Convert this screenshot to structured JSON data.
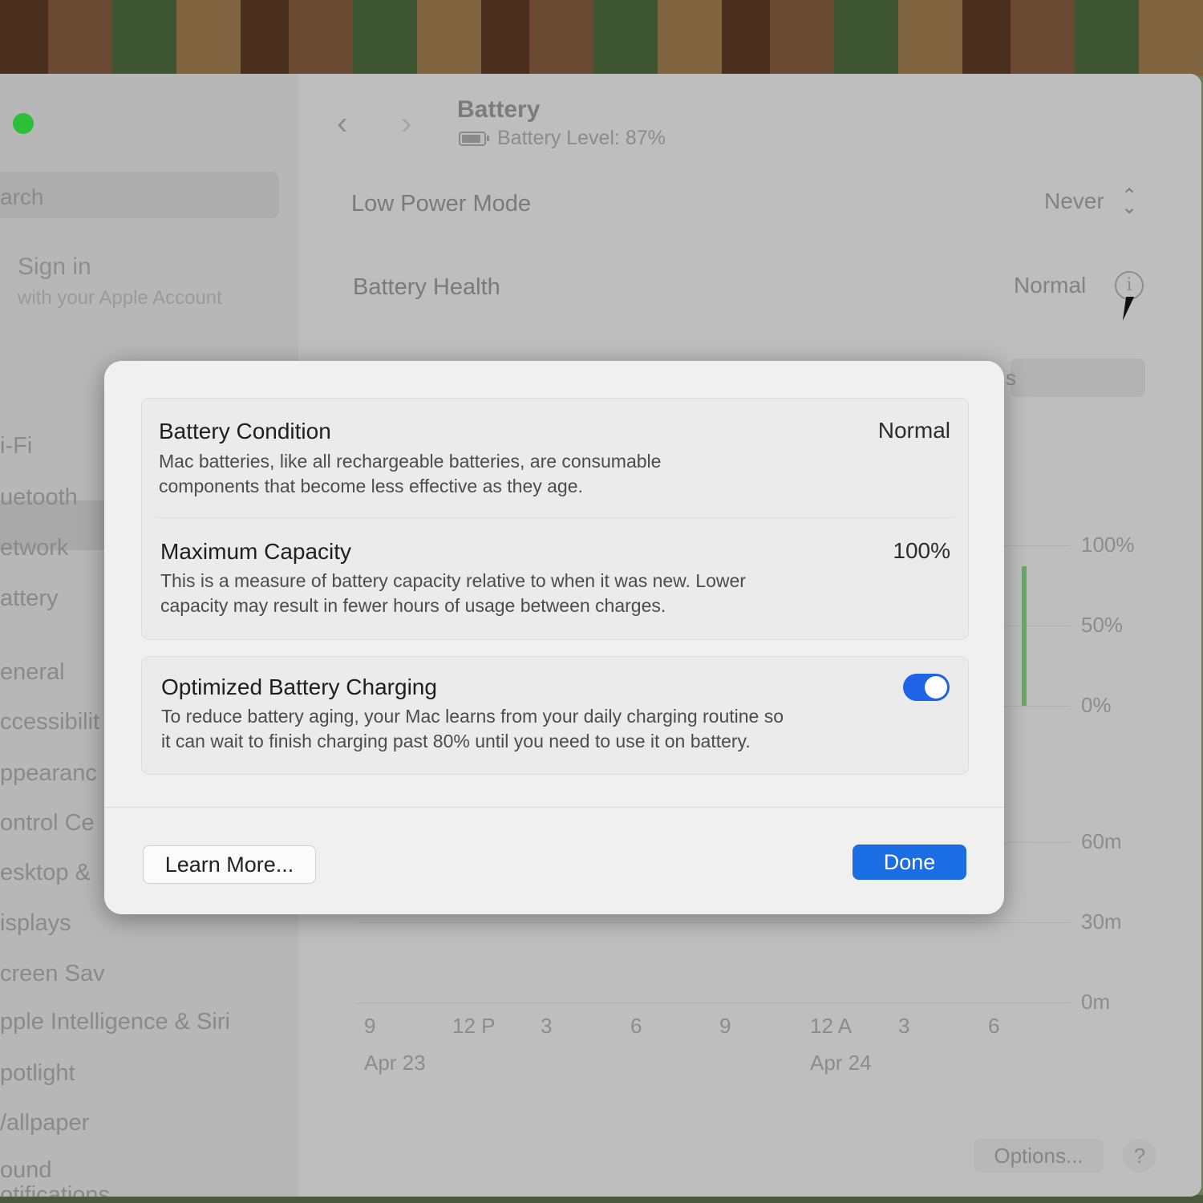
{
  "header": {
    "title": "Battery",
    "battery_level": "Battery Level: 87%",
    "battery_fraction": 0.87
  },
  "sidebar": {
    "search_text": "arch",
    "signin_title": "Sign in",
    "signin_subtitle": "with your Apple Account",
    "items": [
      {
        "label": "i-Fi"
      },
      {
        "label": "uetooth"
      },
      {
        "label": "etwork"
      },
      {
        "label": "attery"
      },
      {
        "label": "eneral"
      },
      {
        "label": "ccessibilit"
      },
      {
        "label": "ppearanc"
      },
      {
        "label": "ontrol Ce"
      },
      {
        "label": "esktop &"
      },
      {
        "label": "isplays"
      },
      {
        "label": "creen Sav"
      },
      {
        "label": "pple Intelligence & Siri"
      },
      {
        "label": "potlight"
      },
      {
        "label": "/allpaper"
      },
      {
        "label": "otifications"
      },
      {
        "label": "ound"
      }
    ]
  },
  "settings": {
    "low_power_label": "Low Power Mode",
    "low_power_value": "Never",
    "health_label": "Battery Health",
    "health_value": "Normal",
    "partial_label": "s"
  },
  "chart": {
    "level_ticks": [
      "100%",
      "50%",
      "0%"
    ],
    "usage_ticks": [
      "60m",
      "30m",
      "0m"
    ],
    "x_ticks": [
      "9",
      "12 P",
      "3",
      "6",
      "9",
      "12 A",
      "3",
      "6"
    ],
    "dates": [
      "Apr 23",
      "Apr 24"
    ]
  },
  "chart_data": {
    "type": "bar",
    "title": "",
    "ylabel": "",
    "ylim": [
      0,
      100
    ],
    "x": [
      "9",
      "12 P",
      "3",
      "6",
      "9",
      "12 A",
      "3",
      "6"
    ],
    "series": [
      {
        "values": [
          null,
          null,
          null,
          null,
          null,
          null,
          null,
          87
        ]
      }
    ]
  },
  "dialog": {
    "items": [
      {
        "title": "Battery Condition",
        "value": "Normal",
        "description_1": "Mac batteries, like all rechargeable batteries, are consumable",
        "description_2": "components that become less effective as they age."
      },
      {
        "title": "Maximum Capacity",
        "value": "100%",
        "description_1": "This is a measure of battery capacity relative to when it was new. Lower",
        "description_2": "capacity may result in fewer hours of usage between charges."
      },
      {
        "title": "Optimized Battery Charging",
        "toggle_on": true,
        "description_1": "To reduce battery aging, your Mac learns from your daily charging routine so",
        "description_2": "it can wait to finish charging past 80% until you need to use it on battery."
      }
    ],
    "learn_more_label": "Learn More...",
    "done_label": "Done"
  },
  "footer": {
    "options_label": "Options...",
    "help_label": "?"
  },
  "colors": {
    "accent": "#1b6de4",
    "toggle_on": "#1f63e6",
    "traffic_green": "#2dbf35",
    "chart_bar": "#6aa765"
  }
}
